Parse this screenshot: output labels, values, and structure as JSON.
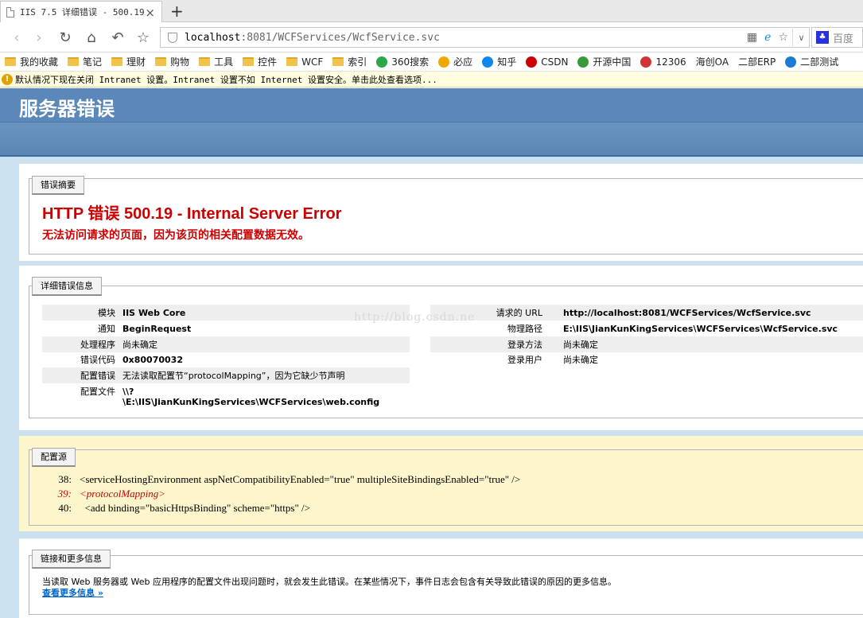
{
  "browser": {
    "tab_title": "IIS 7.5 详细错误 - 500.19",
    "tab_close": "×",
    "new_tab": "+",
    "url_host": "localhost",
    "url_rest": ":8081/WCFServices/WcfService.svc",
    "search_engine": "百度",
    "bookmarks": [
      {
        "label": "我的收藏",
        "icon": "folder-icon"
      },
      {
        "label": "笔记",
        "icon": "folder-icon"
      },
      {
        "label": "理财",
        "icon": "folder-icon"
      },
      {
        "label": "购物",
        "icon": "folder-icon"
      },
      {
        "label": "工具",
        "icon": "folder-icon"
      },
      {
        "label": "控件",
        "icon": "folder-icon"
      },
      {
        "label": "WCF",
        "icon": "folder-icon"
      },
      {
        "label": "索引",
        "icon": "folder-icon"
      },
      {
        "label": "360搜索",
        "icon": "search-360-icon",
        "color": "#2aa84a"
      },
      {
        "label": "必应",
        "icon": "bing-icon",
        "color": "#f0a800"
      },
      {
        "label": "知乎",
        "icon": "zhihu-icon",
        "color": "#0f88eb"
      },
      {
        "label": "CSDN",
        "icon": "csdn-icon",
        "color": "#cc0000"
      },
      {
        "label": "开源中国",
        "icon": "oschina-icon",
        "color": "#3a9a3a"
      },
      {
        "label": "12306",
        "icon": "rail-icon",
        "color": "#d23333"
      },
      {
        "label": "海创OA",
        "icon": "page-icon"
      },
      {
        "label": "二部ERP",
        "icon": "page-icon"
      },
      {
        "label": "二部测试",
        "icon": "zt-icon",
        "color": "#1a7ad4"
      }
    ],
    "infobar_text": "默认情况下现在关闭 Intranet 设置。Intranet 设置不如 Internet 设置安全。单击此处查看选项..."
  },
  "page": {
    "banner_title": "服务器错误",
    "summary": {
      "legend": "错误摘要",
      "title": "HTTP 错误 500.19 - Internal Server Error",
      "subtitle": "无法访问请求的页面，因为该页的相关配置数据无效。"
    },
    "details": {
      "legend": "详细错误信息",
      "left": [
        {
          "label": "模块",
          "value": "IIS Web Core"
        },
        {
          "label": "通知",
          "value": "BeginRequest"
        },
        {
          "label": "处理程序",
          "value": "尚未确定"
        },
        {
          "label": "错误代码",
          "value": "0x80070032"
        },
        {
          "label": "配置错误",
          "value": "无法读取配置节“protocolMapping”，因为它缺少节声明"
        },
        {
          "label": "配置文件",
          "value_line1": "\\\\?",
          "value_line2": "\\E:\\IIS\\JianKunKingServices\\WCFServices\\web.config"
        }
      ],
      "right": [
        {
          "label": "请求的 URL",
          "value": "http://localhost:8081/WCFServices/WcfService.svc"
        },
        {
          "label": "物理路径",
          "value": "E:\\IIS\\JianKunKingServices\\WCFServices\\WcfService.svc"
        },
        {
          "label": "登录方法",
          "value": "尚未确定"
        },
        {
          "label": "登录用户",
          "value": "尚未确定"
        }
      ],
      "watermark": "http://blog.csdn.ne"
    },
    "config_source": {
      "legend": "配置源",
      "lines": [
        {
          "num": "38:",
          "code": "<serviceHostingEnvironment aspNetCompatibilityEnabled=\"true\" multipleSiteBindingsEnabled=\"true\" />"
        },
        {
          "num": "39:",
          "code": "<protocolMapping>"
        },
        {
          "num": "40:",
          "code": "  <add binding=\"basicHttpsBinding\" scheme=\"https\" />"
        }
      ]
    },
    "more_info": {
      "legend": "链接和更多信息",
      "text": "当读取 Web 服务器或 Web 应用程序的配置文件出现问题时，就会发生此错误。在某些情况下，事件日志会包含有关导致此错误的原因的更多信息。",
      "link": "查看更多信息 »"
    }
  }
}
